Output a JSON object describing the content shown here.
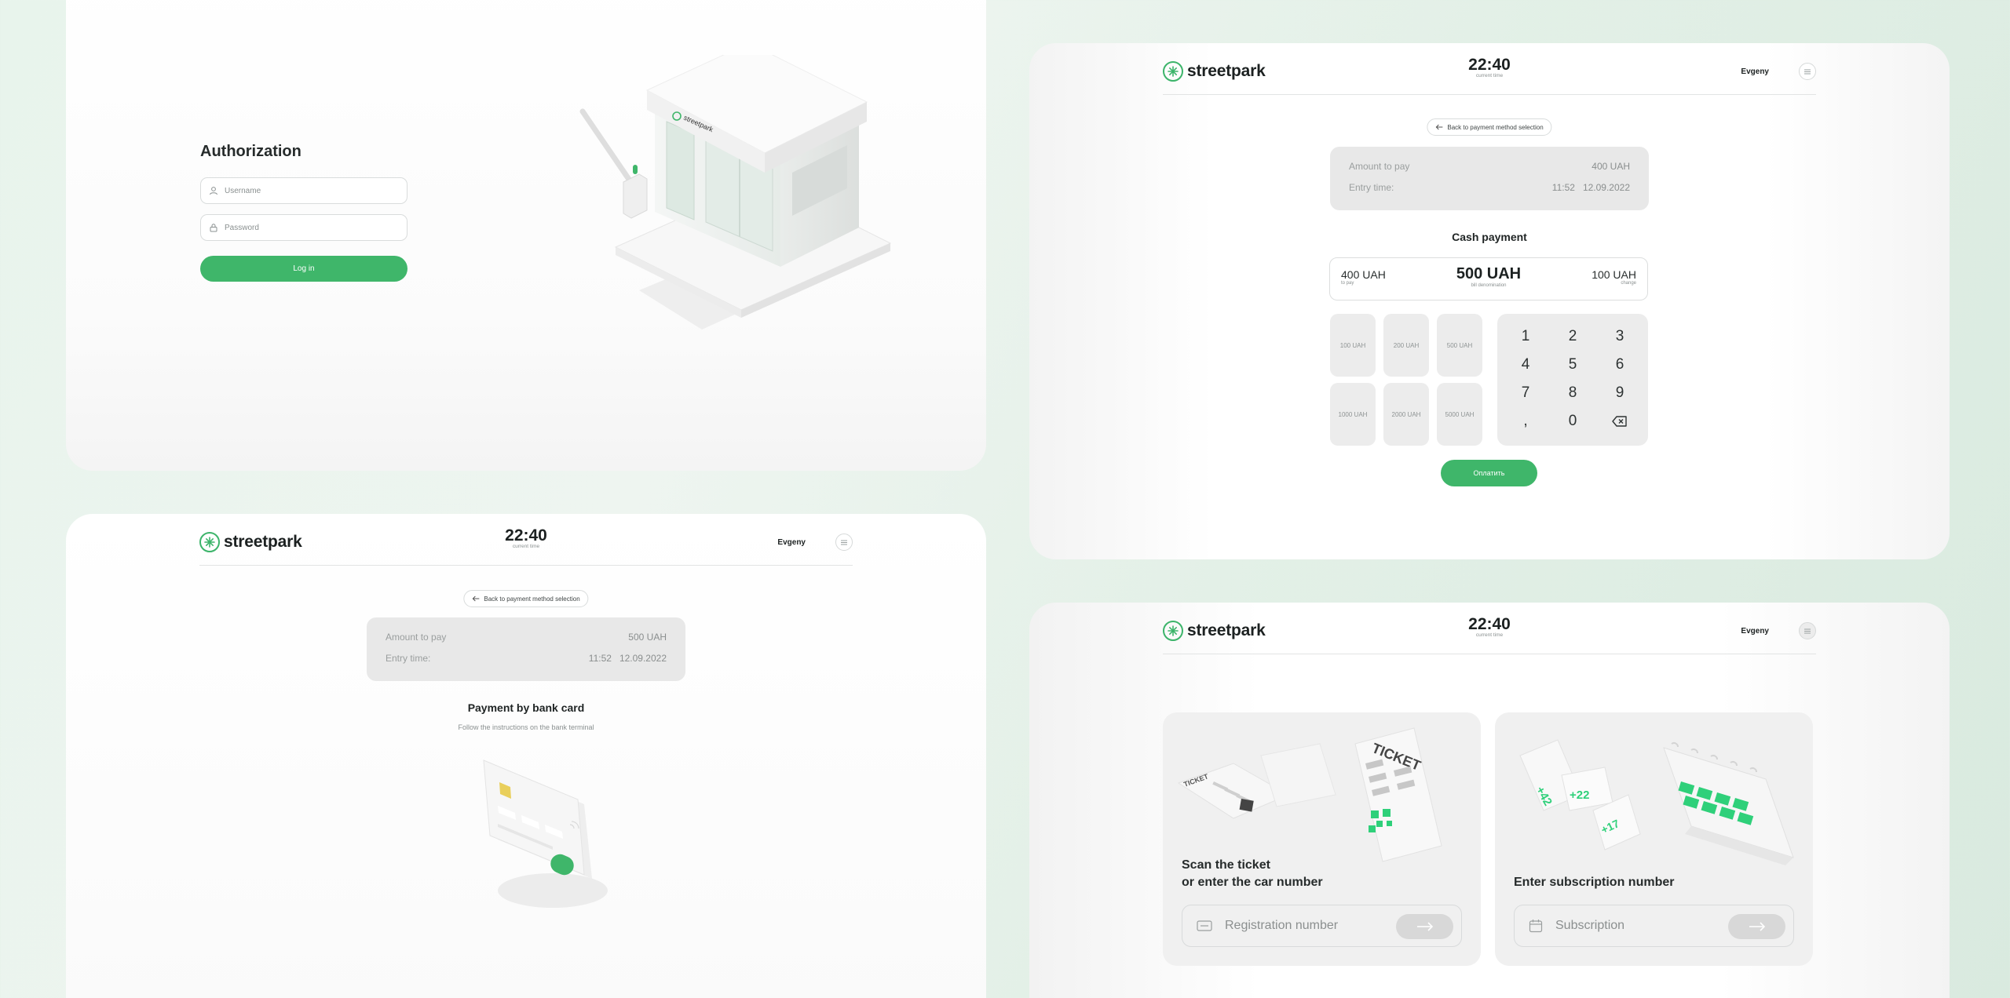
{
  "brand": {
    "name": "streetpark",
    "accent": "#3fb66a"
  },
  "auth": {
    "title": "Authorization",
    "username_placeholder": "Username",
    "password_placeholder": "Password",
    "login_label": "Log in",
    "booth_sign": "streetpark"
  },
  "header": {
    "time": "22:40",
    "time_label": "current time",
    "user": "Evgeny"
  },
  "cash": {
    "back_label": "Back to payment method selection",
    "amount_label": "Amount to pay",
    "amount_value": "400 UAH",
    "entry_label": "Entry time:",
    "entry_value": "11:52   12.09.2022",
    "title": "Cash payment",
    "to_pay_amount": "400 UAH",
    "to_pay_label": "to pay",
    "bill_amount": "500 UAH",
    "bill_label": "bill denomination",
    "change_amount": "100 UAH",
    "change_label": "change",
    "bills": [
      "100 UAH",
      "200 UAH",
      "500 UAH",
      "1000 UAH",
      "2000 UAH",
      "5000 UAH"
    ],
    "keys": [
      "1",
      "2",
      "3",
      "4",
      "5",
      "6",
      "7",
      "8",
      "9",
      ",",
      "0"
    ],
    "pay_label": "Оплатить"
  },
  "card": {
    "back_label": "Back to payment method selection",
    "amount_label": "Amount to pay",
    "amount_value": "500 UAH",
    "entry_label": "Entry time:",
    "entry_value": "11:52   12.09.2022",
    "title": "Payment by bank card",
    "subtitle": "Follow the instructions on the bank terminal"
  },
  "scan": {
    "scan_title_line1": "Scan the ticket",
    "scan_title_line2": "or enter the car number",
    "registration_placeholder": "Registration number",
    "subscription_title": "Enter subscription number",
    "subscription_placeholder": "Subscription",
    "ticket_label": "TICKET",
    "badges": [
      "+42",
      "+22",
      "+17"
    ]
  }
}
